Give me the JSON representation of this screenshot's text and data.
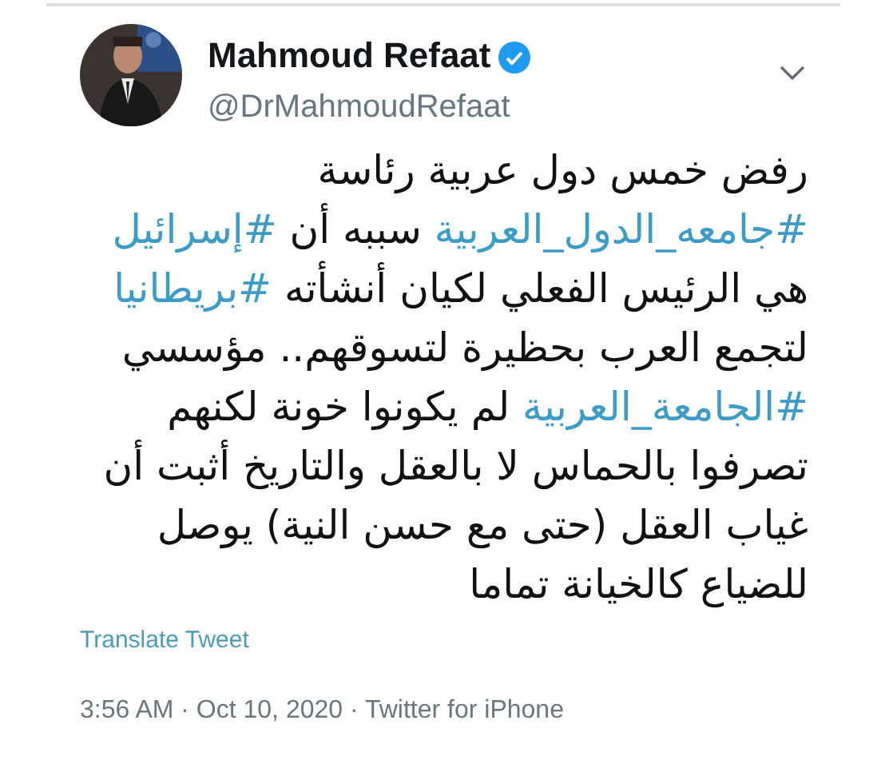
{
  "author": {
    "name": "Mahmoud Refaat",
    "verified": true,
    "handle": "@DrMahmoudRefaat"
  },
  "body": [
    [
      {
        "kind": "text",
        "text": "رفض خمس دول عربية رئاسة"
      }
    ],
    [
      {
        "kind": "hashtag",
        "text": "#جامعه_الدول_العربية"
      },
      {
        "kind": "text",
        "text": " سببه أن "
      },
      {
        "kind": "hashtag",
        "text": "#إسرائيل"
      }
    ],
    [
      {
        "kind": "text",
        "text": "هي الرئيس الفعلي لكيان أنشأته "
      },
      {
        "kind": "hashtag",
        "text": "#بريطانيا"
      }
    ],
    [
      {
        "kind": "text",
        "text": "لتجمع العرب بحظيرة لتسوقهم.. مؤسسي"
      }
    ],
    [
      {
        "kind": "hashtag",
        "text": "#الجامعة_العربية"
      },
      {
        "kind": "text",
        "text": " لم يكونوا خونة لكنهم"
      }
    ],
    [
      {
        "kind": "text",
        "text": "تصرفوا بالحماس لا بالعقل والتاريخ أثبت أن"
      }
    ],
    [
      {
        "kind": "text",
        "text": "غياب العقل (حتى مع حسن النية) يوصل"
      }
    ],
    [
      {
        "kind": "text",
        "text": "للضياع كالخيانة تماما"
      }
    ]
  ],
  "translate": "Translate Tweet",
  "meta": "3:56 AM · Oct 10, 2020 · Twitter for iPhone"
}
